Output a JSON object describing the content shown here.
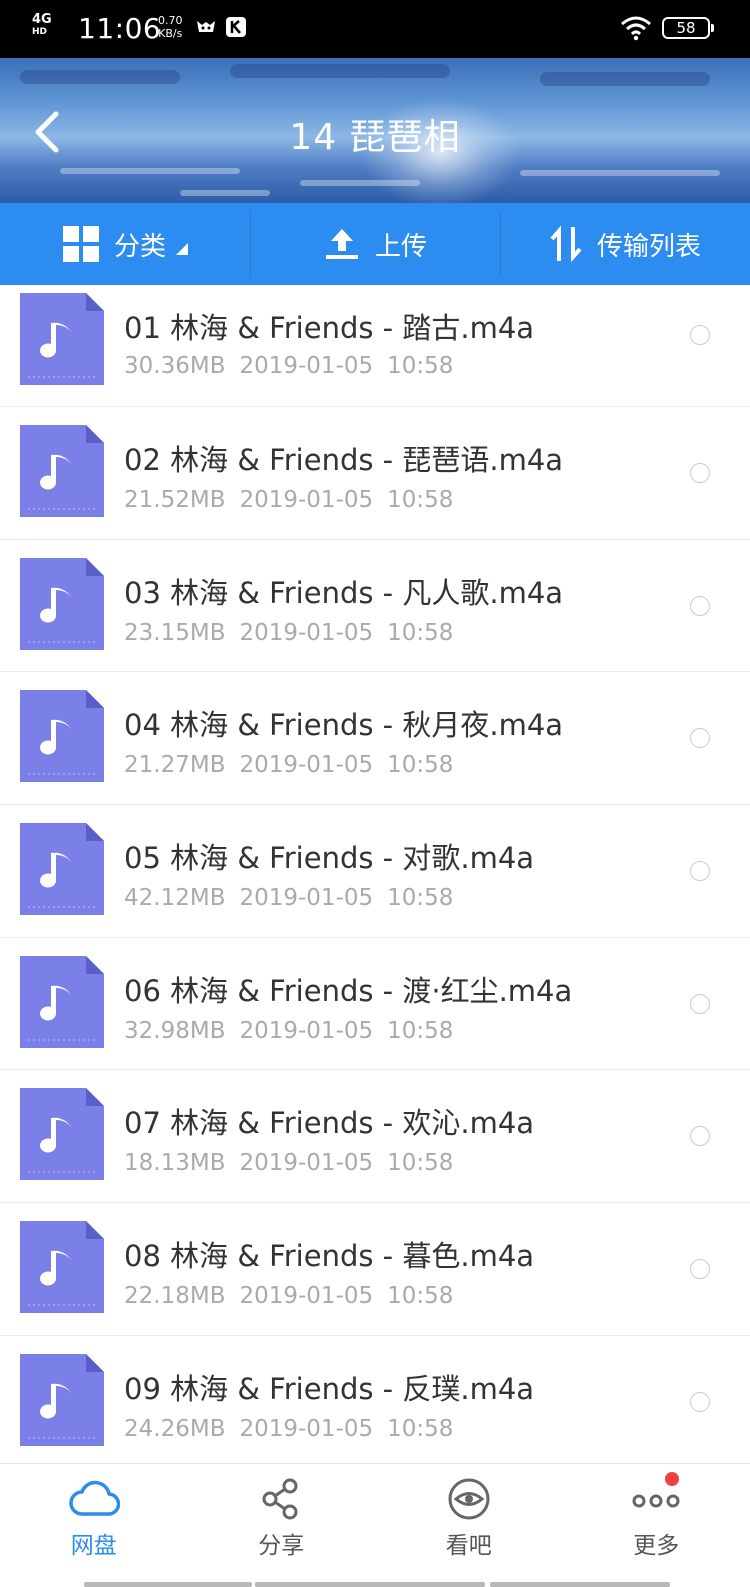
{
  "status_bar": {
    "network": "4G",
    "network_sub": "HD",
    "time": "11:06",
    "speed_value": "0.70",
    "speed_unit": "KB/s",
    "battery": "58"
  },
  "header": {
    "title": "14  琵琶相"
  },
  "toolbar": {
    "category_label": "分类",
    "upload_label": "上传",
    "transfer_label": "传输列表"
  },
  "files": [
    {
      "name": "01 林海 & Friends - 踏古.m4a",
      "size": "30.36MB",
      "date": "2019-01-05",
      "time": "10:58"
    },
    {
      "name": "02 林海 & Friends - 琵琶语.m4a",
      "size": "21.52MB",
      "date": "2019-01-05",
      "time": "10:58"
    },
    {
      "name": "03 林海 & Friends - 凡人歌.m4a",
      "size": "23.15MB",
      "date": "2019-01-05",
      "time": "10:58"
    },
    {
      "name": "04 林海 & Friends - 秋月夜.m4a",
      "size": "21.27MB",
      "date": "2019-01-05",
      "time": "10:58"
    },
    {
      "name": "05 林海 & Friends - 对歌.m4a",
      "size": "42.12MB",
      "date": "2019-01-05",
      "time": "10:58"
    },
    {
      "name": "06 林海 & Friends - 渡·红尘.m4a",
      "size": "32.98MB",
      "date": "2019-01-05",
      "time": "10:58"
    },
    {
      "name": "07 林海 & Friends - 欢沁.m4a",
      "size": "18.13MB",
      "date": "2019-01-05",
      "time": "10:58"
    },
    {
      "name": "08 林海 & Friends - 暮色.m4a",
      "size": "22.18MB",
      "date": "2019-01-05",
      "time": "10:58"
    },
    {
      "name": "09 林海 & Friends - 反璞.m4a",
      "size": "24.26MB",
      "date": "2019-01-05",
      "time": "10:58"
    }
  ],
  "bottom_nav": {
    "items": [
      {
        "label": "网盘",
        "icon": "cloud-icon",
        "active": true
      },
      {
        "label": "分享",
        "icon": "share-icon",
        "active": false
      },
      {
        "label": "看吧",
        "icon": "eye-icon",
        "active": false
      },
      {
        "label": "更多",
        "icon": "more-icon",
        "active": false
      }
    ]
  },
  "colors": {
    "accent": "#2d8cf0",
    "file_icon": "#7b7fe8",
    "badge": "#f04040"
  }
}
